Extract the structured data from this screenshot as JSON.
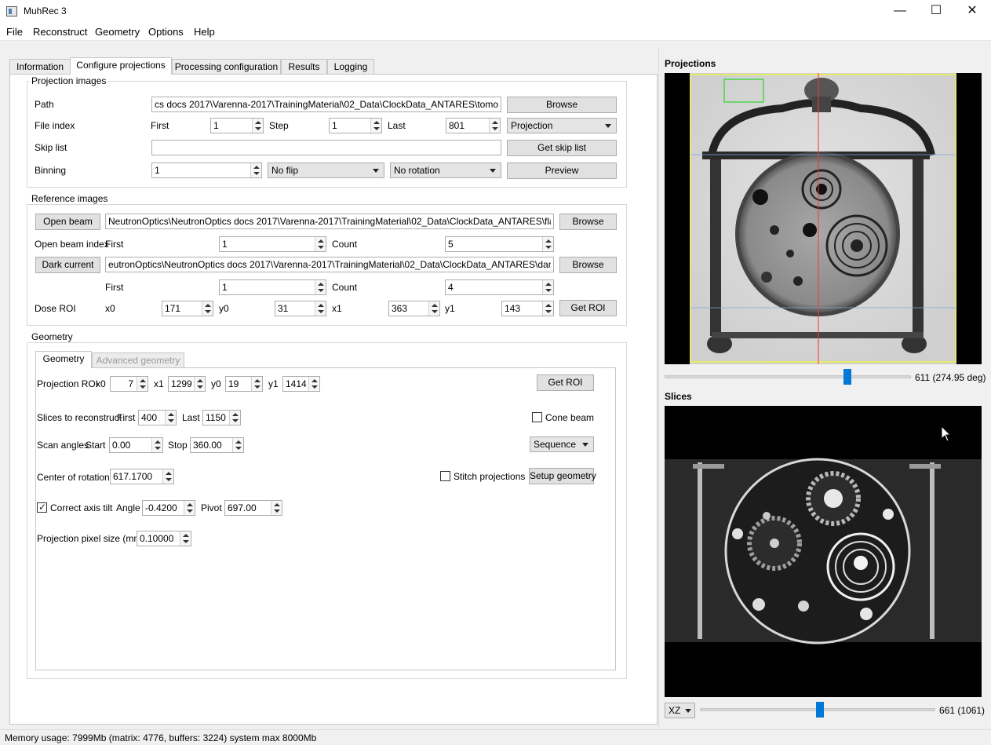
{
  "window": {
    "title": "MuhRec 3",
    "minimize": "—",
    "maximize": "☐",
    "close": "✕"
  },
  "menu": [
    "File",
    "Reconstruct",
    "Geometry",
    "Options",
    "Help"
  ],
  "tabs": [
    "Information",
    "Configure projections",
    "Processing configuration",
    "Results",
    "Logging"
  ],
  "projection_images": {
    "title": "Projection images",
    "path_label": "Path",
    "path_value": "cs docs 2017\\Varenna-2017\\TrainingMaterial\\02_Data\\ClockData_ANTARES\\tomo_####.tif",
    "browse": "Browse",
    "file_index_label": "File index",
    "first_label": "First",
    "first": "1",
    "step_label": "Step",
    "step": "1",
    "last_label": "Last",
    "last": "801",
    "type_value": "Projection",
    "skip_label": "Skip list",
    "skip_value": "",
    "get_skip": "Get skip list",
    "binning_label": "Binning",
    "binning": "1",
    "flip": "No flip",
    "rotation": "No rotation",
    "preview": "Preview"
  },
  "reference_images": {
    "title": "Reference images",
    "open_beam_button": "Open beam",
    "open_beam_path": "NeutronOptics\\NeutronOptics docs 2017\\Varenna-2017\\TrainingMaterial\\02_Data\\ClockData_ANTARES\\flat_####.tif",
    "browse": "Browse",
    "ob_index_label": "Open beam index",
    "first_label": "First",
    "ob_first": "1",
    "count_label": "Count",
    "ob_count": "5",
    "dark_button": "Dark current",
    "dark_path": "eutronOptics\\NeutronOptics docs 2017\\Varenna-2017\\TrainingMaterial\\02_Data\\ClockData_ANTARES\\dark_####.tif",
    "dc_first": "1",
    "dc_count": "4",
    "dose_label": "Dose ROI",
    "x0_label": "x0",
    "x0": "171",
    "y0_label": "y0",
    "y0": "31",
    "x1_label": "x1",
    "x1": "363",
    "y1_label": "y1",
    "y1": "143",
    "get_roi": "Get ROI"
  },
  "geometry": {
    "title": "Geometry",
    "tabs": [
      "Geometry",
      "Advanced geometry"
    ],
    "proj_roi_label": "Projection ROI",
    "x0_label": "x0",
    "x0": "7",
    "x1_label": "x1",
    "x1": "1299",
    "y0_label": "y0",
    "y0": "19",
    "y1_label": "y1",
    "y1": "1414",
    "get_roi": "Get ROI",
    "slices_label": "Slices to reconstruct",
    "first_label": "First",
    "first": "400",
    "last_label": "Last",
    "last": "1150",
    "cone_beam": "Cone beam",
    "scan_label": "Scan angles",
    "start_label": "Start",
    "start": "0.00",
    "stop_label": "Stop",
    "stop": "360.00",
    "sequence": "Sequence",
    "cor_label": "Center of rotation",
    "cor": "617.1700",
    "stitch": "Stitch projections",
    "setup_geometry": "Setup geometry",
    "tilt_label": "Correct axis tilt",
    "angle_label": "Angle",
    "angle": "-0.4200",
    "pivot_label": "Pivot",
    "pivot": "697.00",
    "pixel_label": "Projection pixel size (mm)",
    "pixel": "0.10000"
  },
  "projections_panel": {
    "title": "Projections",
    "readout": "611 (274.95 deg)",
    "slider_fraction": 0.75
  },
  "slices_panel": {
    "title": "Slices",
    "plane": "XZ",
    "readout": "661 (1061)",
    "slider_fraction": 0.51
  },
  "status": "Memory usage: 7999Mb (matrix: 4776, buffers: 3224) system max 8000Mb",
  "colors": {
    "accent": "#0078d7",
    "roi_box": "#2bd62b",
    "axis_line": "#ff3333",
    "crop_frame": "#ffff00"
  }
}
